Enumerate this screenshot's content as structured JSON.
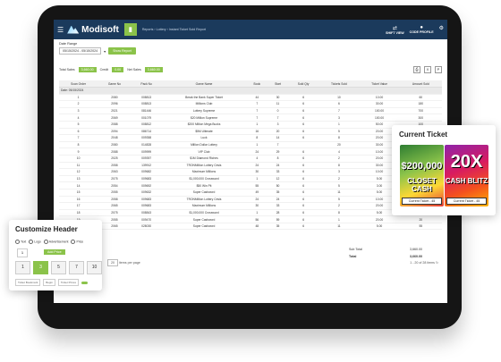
{
  "app": {
    "title": "Modisoft",
    "breadcrumb": "Reports › Lottery › Instant Ticket Sold Report"
  },
  "topbar": {
    "right_items": [
      {
        "label": "SHIFT VIEW"
      },
      {
        "label": "CODE PROFILE"
      }
    ]
  },
  "filters": {
    "label": "Date Range",
    "date_value": "05/15/2024 - 05/15/2024",
    "apply_label": "Show Report"
  },
  "totals": {
    "total_sales_label": "Total Sales",
    "total_sales_value": "3,660.00",
    "credit_label": "Credit",
    "credit_value": "0.00",
    "net_sales_label": "Net Sales",
    "net_sales_value": "3,660.00"
  },
  "table": {
    "columns": [
      "Scan Order",
      "Game No",
      "Pack No",
      "Game Name",
      "Book",
      "Start",
      "Sold Qty",
      "Tickets Sold",
      "Ticket Value",
      "Amount Sold"
    ],
    "group_label": "Date: 05/15/2024",
    "rows": [
      [
        "1",
        "2080",
        "008813",
        "Break the Bank Super Ticket",
        "44",
        "30",
        "6",
        "10",
        "10.00",
        "60"
      ],
      [
        "2",
        "2096",
        "008813",
        "Millions Club",
        "7",
        "11",
        "6",
        "6",
        "30.00",
        "180"
      ],
      [
        "3",
        "2021",
        "081446",
        "Lottery Supreme",
        "7",
        "0",
        "6",
        "7",
        "100.00",
        "700"
      ],
      [
        "4",
        "2069",
        "001079",
        "$20 Million Supreme",
        "7",
        "7",
        "6",
        "3",
        "100.00",
        "300"
      ],
      [
        "5",
        "2088",
        "008812",
        "$200 Million Mega Bucks",
        "1",
        "3",
        "6",
        "1",
        "50.00",
        "100"
      ],
      [
        "6",
        "2094",
        "086714",
        "$5M Ultimate",
        "16",
        "20",
        "6",
        "5",
        "20.00",
        "80"
      ],
      [
        "7",
        "2048",
        "009358",
        "Luck",
        "8",
        "14",
        "6",
        "8",
        "20.00",
        "160"
      ],
      [
        "8",
        "2080",
        "014828",
        "Million Dollar Lottery",
        "1",
        "7",
        "",
        "20",
        "30.00",
        "600"
      ],
      [
        "9",
        "2088",
        "009999",
        "VIP Club",
        "24",
        "29",
        "6",
        "4",
        "10.00",
        "40"
      ],
      [
        "10",
        "2025",
        "009397",
        "$1M Diamond Riches",
        "4",
        "8",
        "6",
        "2",
        "20.00",
        "40"
      ],
      [
        "11",
        "2058",
        "139912",
        "TRONMillion Lottery Crisis",
        "24",
        "24",
        "6",
        "8",
        "30.00",
        "240"
      ],
      [
        "12",
        "2063",
        "009682",
        "Maximum Millions",
        "30",
        "33",
        "6",
        "3",
        "10.00",
        "30"
      ],
      [
        "13",
        "2075",
        "009683",
        "$1,000,000 Crossword",
        "1",
        "12",
        "6",
        "2",
        "5.00",
        "10"
      ],
      [
        "14",
        "2054",
        "009692",
        "$50 Win Pit",
        "55",
        "50",
        "6",
        "5",
        "3.00",
        "15"
      ],
      [
        "15",
        "2055",
        "009632",
        "Super Cashword",
        "49",
        "35",
        "6",
        "11",
        "5.00",
        "55"
      ],
      [
        "16",
        "2058",
        "009683",
        "TRONMillion Lottery Crisis",
        "24",
        "24",
        "6",
        "5",
        "10.00",
        "50"
      ],
      [
        "17",
        "2065",
        "009683",
        "Maximum Millions",
        "30",
        "33",
        "6",
        "2",
        "20.00",
        "40"
      ],
      [
        "18",
        "2075",
        "008843",
        "$1,000,000 Crossword",
        "1",
        "28",
        "6",
        "8",
        "5.00",
        "40"
      ],
      [
        "19",
        "2055",
        "009470",
        "Super Cashword",
        "56",
        "59",
        "6",
        "1",
        "20.00",
        "20"
      ],
      [
        "20",
        "2065",
        "028030",
        "Super Cashword",
        "48",
        "35",
        "6",
        "11",
        "5.00",
        "55"
      ]
    ],
    "subtotal_label": "Sub Total",
    "subtotal_value": "3,660.00",
    "total_label": "Total",
    "total_value": "3,660.00"
  },
  "pager": {
    "page_size": "20",
    "page_size_label": "items per page",
    "range_label": "1 - 20 of 28 items"
  },
  "current_ticket": {
    "title": "Current Ticket",
    "tickets": [
      {
        "headline": "$200,000",
        "subline": "CLOSET CASH",
        "label": "Current Ticket - 45"
      },
      {
        "headline": "20X",
        "subline": "CASH BLITZ",
        "label": "Current Ticket - 45"
      }
    ]
  },
  "customize": {
    "title": "Customize Header",
    "options": [
      "Text",
      "Logo",
      "Advertisement",
      "Price"
    ],
    "qty": "1",
    "add_label": "Add Price",
    "denominations": [
      "1",
      "3",
      "5",
      "7",
      "10"
    ],
    "selected_index": 1,
    "footer": [
      "Ticket Bookmark",
      "Begin",
      "Ticket Prices"
    ]
  },
  "colors": {
    "accent": "#8bc34a",
    "navbar": "#1b3a5c"
  }
}
